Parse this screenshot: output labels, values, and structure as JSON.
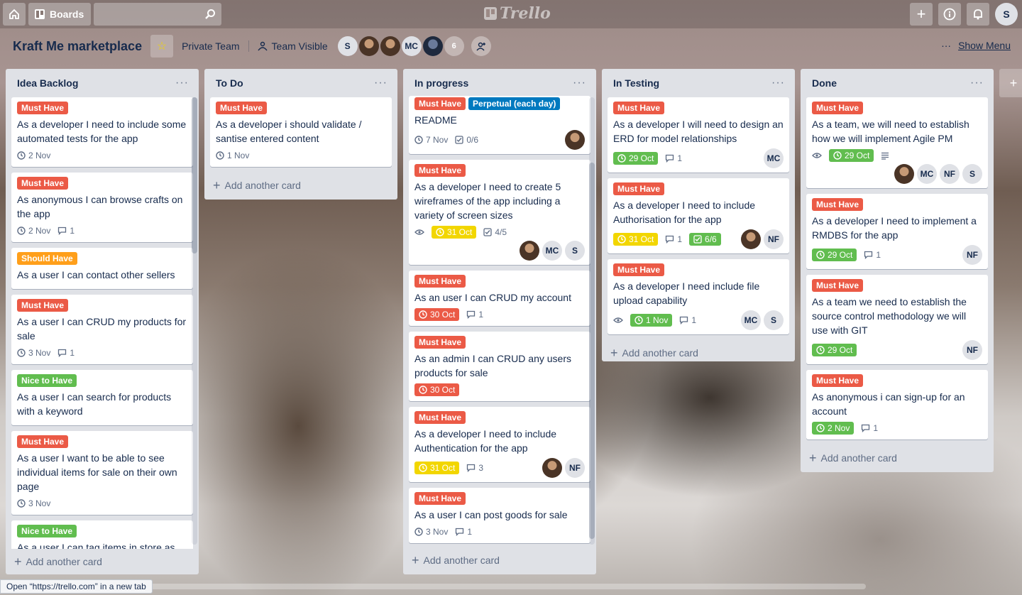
{
  "topbar": {
    "home_icon": "home-icon",
    "boards_label": "Boards",
    "search_placeholder": "",
    "logo": "Trello",
    "user_initial": "S"
  },
  "header": {
    "board_title": "Kraft Me marketplace",
    "team": "Private Team",
    "visibility": "Team Visible",
    "members": [
      {
        "initials": "S",
        "photo": false
      },
      {
        "initials": "",
        "photo": true
      },
      {
        "initials": "",
        "photo": true
      },
      {
        "initials": "MC",
        "photo": false
      },
      {
        "initials": "",
        "photo": true
      }
    ],
    "member_count": "6",
    "show_menu": "Show Menu"
  },
  "colors": {
    "red": "#eb5a46",
    "orange": "#ff9f1a",
    "green": "#61bd4f",
    "blue": "#0079bf",
    "yellow": "#f2d600"
  },
  "lists": [
    {
      "title": "Idea Backlog",
      "add_card": "Add another card",
      "cards": [
        {
          "labels": [
            {
              "text": "Must Have",
              "color": "red"
            }
          ],
          "title": "As a developer I need to include some automated tests for the app",
          "date": "2 Nov"
        },
        {
          "labels": [
            {
              "text": "Must Have",
              "color": "red"
            }
          ],
          "title": "As anonymous I can browse crafts on the app",
          "date": "2 Nov",
          "comments": "1"
        },
        {
          "labels": [
            {
              "text": "Should Have",
              "color": "orange"
            }
          ],
          "title": "As a user I can contact other sellers"
        },
        {
          "labels": [
            {
              "text": "Must Have",
              "color": "red"
            }
          ],
          "title": "As a user I can CRUD my products for sale",
          "date": "3 Nov",
          "comments": "1"
        },
        {
          "labels": [
            {
              "text": "Nice to Have",
              "color": "green"
            }
          ],
          "title": "As a user I can search for products with a keyword"
        },
        {
          "labels": [
            {
              "text": "Must Have",
              "color": "red"
            }
          ],
          "title": "As a user I want to be able to see individual items for sale on their own page",
          "date": "3 Nov"
        },
        {
          "labels": [
            {
              "text": "Nice to Have",
              "color": "green"
            }
          ],
          "title": "As a user I can tag items in store as"
        }
      ]
    },
    {
      "title": "To Do",
      "add_card": "Add another card",
      "cards": [
        {
          "labels": [
            {
              "text": "Must Have",
              "color": "red"
            }
          ],
          "title": "As a developer i should validate / santise entered content",
          "date": "1 Nov"
        }
      ]
    },
    {
      "title": "In progress",
      "add_card": "Add another card",
      "cards": [
        {
          "labels": [
            {
              "text": "Must Have",
              "color": "red"
            },
            {
              "text": "Perpetual (each day)",
              "color": "blue"
            }
          ],
          "title": "README",
          "date": "7 Nov",
          "checklist": "0/6",
          "members": [
            "photo"
          ]
        },
        {
          "labels": [
            {
              "text": "Must Have",
              "color": "red"
            }
          ],
          "title": "As a developer I need to create 5 wireframes of the app including a variety of screen sizes",
          "watch": true,
          "due": {
            "text": "31 Oct",
            "color": "yellow"
          },
          "checklist": "4/5",
          "members": [
            "photo",
            "MC",
            "S"
          ]
        },
        {
          "labels": [
            {
              "text": "Must Have",
              "color": "red"
            }
          ],
          "title": "As an user I can CRUD my account",
          "due": {
            "text": "30 Oct",
            "color": "red"
          },
          "comments": "1"
        },
        {
          "labels": [
            {
              "text": "Must Have",
              "color": "red"
            }
          ],
          "title": "As an admin I can CRUD any users products for sale",
          "due": {
            "text": "30 Oct",
            "color": "red"
          }
        },
        {
          "labels": [
            {
              "text": "Must Have",
              "color": "red"
            }
          ],
          "title": "As a developer I need to include Authentication for the app",
          "due": {
            "text": "31 Oct",
            "color": "yellow"
          },
          "comments": "3",
          "members": [
            "photo",
            "NF"
          ]
        },
        {
          "labels": [
            {
              "text": "Must Have",
              "color": "red"
            }
          ],
          "title": "As a user I can post goods for sale",
          "date": "3 Nov",
          "comments": "1"
        }
      ]
    },
    {
      "title": "In Testing",
      "add_card": "Add another card",
      "cards": [
        {
          "labels": [
            {
              "text": "Must Have",
              "color": "red"
            }
          ],
          "title": "As a developer I will need to design an ERD for model relationships",
          "due": {
            "text": "29 Oct",
            "color": "green"
          },
          "comments": "1",
          "members": [
            "MC"
          ]
        },
        {
          "labels": [
            {
              "text": "Must Have",
              "color": "red"
            }
          ],
          "title": "As a developer I need to include Authorisation for the app",
          "due": {
            "text": "31 Oct",
            "color": "yellow"
          },
          "comments": "1",
          "checklist_done": "6/6",
          "members": [
            "photo",
            "NF"
          ]
        },
        {
          "labels": [
            {
              "text": "Must Have",
              "color": "red"
            }
          ],
          "title": "As a developer I need include file upload capability",
          "watch": true,
          "due": {
            "text": "1 Nov",
            "color": "green"
          },
          "comments": "1",
          "members": [
            "MC",
            "S"
          ]
        }
      ]
    },
    {
      "title": "Done",
      "add_card": "Add another card",
      "cards": [
        {
          "labels": [
            {
              "text": "Must Have",
              "color": "red"
            }
          ],
          "title": "As a team, we will need to establish how we will implement Agile PM",
          "watch": true,
          "due": {
            "text": "29 Oct",
            "color": "green"
          },
          "description": true,
          "members": [
            "photo",
            "MC",
            "NF",
            "S"
          ]
        },
        {
          "labels": [
            {
              "text": "Must Have",
              "color": "red"
            }
          ],
          "title": "As a developer I need to implement a RMDBS for the app",
          "due": {
            "text": "29 Oct",
            "color": "green"
          },
          "comments": "1",
          "members": [
            "NF"
          ]
        },
        {
          "labels": [
            {
              "text": "Must Have",
              "color": "red"
            }
          ],
          "title": "As a team we need to establish the source control methodology we will use with GIT",
          "due": {
            "text": "29 Oct",
            "color": "green"
          },
          "members": [
            "NF"
          ]
        },
        {
          "labels": [
            {
              "text": "Must Have",
              "color": "red"
            }
          ],
          "title": "As anonymous i can sign-up for an account",
          "due": {
            "text": "2 Nov",
            "color": "green"
          },
          "comments": "1"
        }
      ]
    }
  ],
  "status_bar": "Open “https://trello.com” in a new tab"
}
